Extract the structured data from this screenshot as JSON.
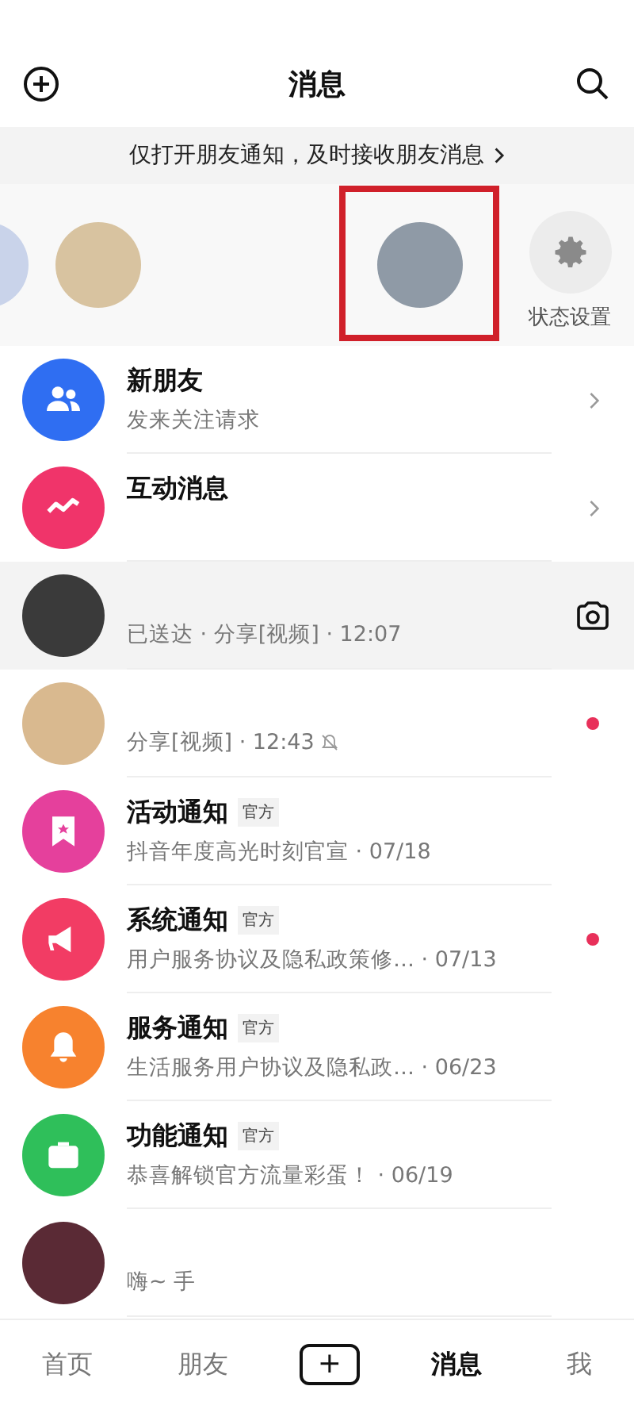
{
  "header": {
    "title": "消息"
  },
  "banner": {
    "text": "仅打开朋友通知，及时接收朋友消息"
  },
  "stories": [
    {
      "kind": "avatar",
      "color": "#c9d3ea",
      "highlighted": false
    },
    {
      "kind": "avatar",
      "color": "#d8c3a0",
      "highlighted": false
    },
    {
      "kind": "avatar",
      "color": "#8f9aa6",
      "highlighted": true
    },
    {
      "kind": "settings",
      "label": "状态设置",
      "highlighted": false
    }
  ],
  "rows": [
    {
      "kind": "friends",
      "color": "#2f6ef2",
      "title": "新朋友",
      "subtitle": "发来关注请求",
      "chevron": true,
      "unread": false,
      "pinned": false,
      "muted": false
    },
    {
      "kind": "interactions",
      "color": "#f0346a",
      "title": "互动消息",
      "chevron": true,
      "unread": false,
      "pinned": false,
      "muted": false
    },
    {
      "kind": "chat",
      "color": "#3a3a3a",
      "subtitle": "已送达 · 分享[视频] · 12:07",
      "camera": true,
      "chevron": false,
      "unread": false,
      "pinned": true,
      "muted": false
    },
    {
      "kind": "chat",
      "color": "#d9b98f",
      "subtitle": "分享[视频] · 12:43",
      "chevron": false,
      "unread": true,
      "pinned": false,
      "muted": true
    },
    {
      "kind": "activity",
      "color": "#e5409c",
      "title": "活动通知",
      "badge": "官方",
      "subtitle": "抖音年度高光时刻官宣 · 07/18",
      "chevron": false,
      "unread": false,
      "pinned": false,
      "muted": false
    },
    {
      "kind": "system",
      "color": "#f23c64",
      "title": "系统通知",
      "badge": "官方",
      "subtitle": "用户服务协议及隐私政策修… · 07/13",
      "chevron": false,
      "unread": true,
      "pinned": false,
      "muted": false
    },
    {
      "kind": "service",
      "color": "#f7822e",
      "title": "服务通知",
      "badge": "官方",
      "subtitle": "生活服务用户协议及隐私政… · 06/23",
      "chevron": false,
      "unread": false,
      "pinned": false,
      "muted": false
    },
    {
      "kind": "feature",
      "color": "#2fbf5a",
      "title": "功能通知",
      "badge": "官方",
      "subtitle": "恭喜解锁官方流量彩蛋！ · 06/19",
      "chevron": false,
      "unread": false,
      "pinned": false,
      "muted": false
    },
    {
      "kind": "chat",
      "color": "#5a2a35",
      "subtitle": "嗨~ 手",
      "chevron": false,
      "unread": false,
      "pinned": false,
      "muted": false
    }
  ],
  "tabs": [
    {
      "kind": "text",
      "label": "首页",
      "selected": false
    },
    {
      "kind": "text",
      "label": "朋友",
      "selected": false
    },
    {
      "kind": "add",
      "label": "+",
      "selected": false
    },
    {
      "kind": "text",
      "label": "消息",
      "selected": true
    },
    {
      "kind": "text",
      "label": "我",
      "selected": false
    }
  ]
}
